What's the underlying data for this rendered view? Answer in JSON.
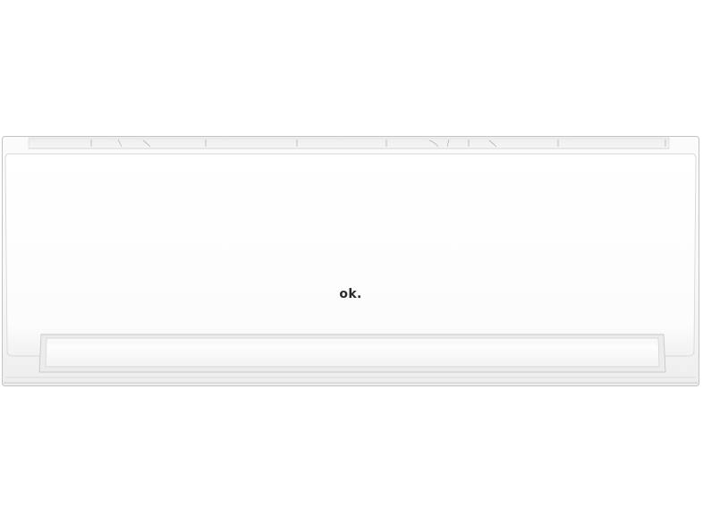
{
  "product": {
    "type": "wall-mounted split air conditioner indoor unit",
    "brand_logo_text": "ok.",
    "body_color": "#f7f7f7",
    "outline_color": "#c9c9c9",
    "logo_color": "#2a2a2a"
  }
}
